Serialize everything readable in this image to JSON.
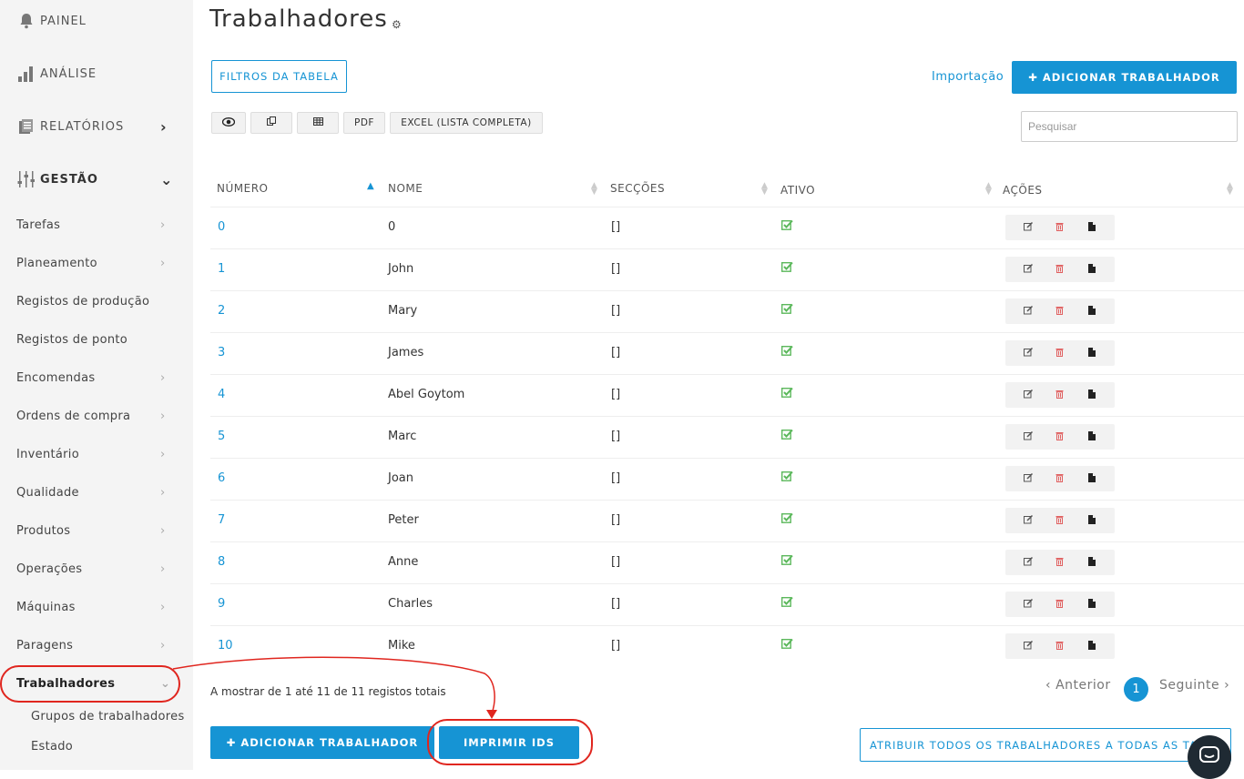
{
  "sidebar": {
    "top": [
      {
        "label": "PAINEL",
        "icon": "bell-icon"
      },
      {
        "label": "ANÁLISE",
        "icon": "bar-chart-icon"
      },
      {
        "label": "RELATÓRIOS",
        "icon": "reports-icon"
      },
      {
        "label": "GESTÃO",
        "icon": "sliders-icon"
      }
    ],
    "items": [
      {
        "label": "Tarefas"
      },
      {
        "label": "Planeamento"
      },
      {
        "label": "Registos de produção"
      },
      {
        "label": "Registos de ponto"
      },
      {
        "label": "Encomendas"
      },
      {
        "label": "Ordens de compra"
      },
      {
        "label": "Inventário"
      },
      {
        "label": "Qualidade"
      },
      {
        "label": "Produtos"
      },
      {
        "label": "Operações"
      },
      {
        "label": "Máquinas"
      },
      {
        "label": "Paragens"
      },
      {
        "label": "Trabalhadores"
      }
    ],
    "subitems": [
      {
        "label": "Grupos de trabalhadores"
      },
      {
        "label": "Estado"
      }
    ]
  },
  "page": {
    "title": "Trabalhadores",
    "filters_label": "FILTROS DA TABELA",
    "import_label": "Importação",
    "add_worker_label": "ADICIONAR TRABALHADOR",
    "search_placeholder": "Pesquisar",
    "toolbar": {
      "pdf": "PDF",
      "excel": "EXCEL (LISTA COMPLETA)"
    }
  },
  "table": {
    "headers": [
      "NÚMERO",
      "NOME",
      "SECÇÕES",
      "ATIVO",
      "AÇÕES"
    ],
    "rows": [
      {
        "num": "0",
        "name": "0",
        "sections": "[]"
      },
      {
        "num": "1",
        "name": "John",
        "sections": "[]"
      },
      {
        "num": "2",
        "name": "Mary",
        "sections": "[]"
      },
      {
        "num": "3",
        "name": "James",
        "sections": "[]"
      },
      {
        "num": "4",
        "name": "Abel Goytom",
        "sections": "[]"
      },
      {
        "num": "5",
        "name": "Marc",
        "sections": "[]"
      },
      {
        "num": "6",
        "name": "Joan",
        "sections": "[]"
      },
      {
        "num": "7",
        "name": "Peter",
        "sections": "[]"
      },
      {
        "num": "8",
        "name": "Anne",
        "sections": "[]"
      },
      {
        "num": "9",
        "name": "Charles",
        "sections": "[]"
      },
      {
        "num": "10",
        "name": "Mike",
        "sections": "[]"
      }
    ]
  },
  "footer": {
    "info": "A mostrar de 1 até 11 de 11 registos totais",
    "prev": "Anterior",
    "page": "1",
    "next": "Seguinte",
    "add_worker": "ADICIONAR TRABALHADOR",
    "print_ids": "IMPRIMIR IDS",
    "assign_all": "ATRIBUIR TODOS OS TRABALHADORES A TODAS AS TAR"
  },
  "colors": {
    "accent": "#1694d4",
    "highlight": "#e0261f",
    "active": "#5cb85c",
    "delete": "#e06060"
  }
}
